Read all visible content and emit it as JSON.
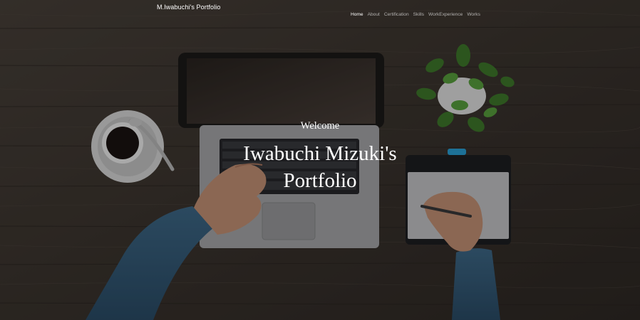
{
  "navbar": {
    "brand": "M.Iwabuchi's Portfolio",
    "links": [
      {
        "label": "Home",
        "active": true
      },
      {
        "label": "About",
        "active": false
      },
      {
        "label": "Certification",
        "active": false
      },
      {
        "label": "Skills",
        "active": false
      },
      {
        "label": "WorkExperience",
        "active": false
      },
      {
        "label": "Works",
        "active": false
      }
    ]
  },
  "hero": {
    "welcome": "Welcome",
    "title_line1": "Iwabuchi Mizuki's",
    "title_line2": "Portfolio"
  },
  "colors": {
    "text": "#ffffff",
    "nav_inactive": "rgba(255,255,255,0.62)",
    "wood": "#3b342e"
  }
}
